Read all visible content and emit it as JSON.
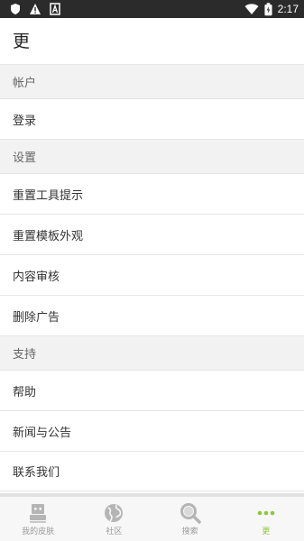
{
  "status_bar": {
    "time": "2:17",
    "icons": [
      "shield-icon",
      "warning-icon",
      "a-icon",
      "wifi-icon",
      "battery-icon"
    ]
  },
  "header": {
    "title": "更"
  },
  "sections": {
    "account": {
      "title": "帐户",
      "items": [
        "登录"
      ]
    },
    "settings": {
      "title": "设置",
      "items": [
        "重置工具提示",
        "重置模板外观",
        "内容审核",
        "删除广告"
      ]
    },
    "support": {
      "title": "支持",
      "items": [
        "帮助",
        "新闻与公告",
        "联系我们"
      ]
    }
  },
  "bottom_nav": {
    "items": [
      {
        "label": "我的皮肤",
        "icon": "skin-icon"
      },
      {
        "label": "社区",
        "icon": "globe-icon"
      },
      {
        "label": "搜索",
        "icon": "search-icon"
      },
      {
        "label": "更",
        "icon": "more-icon"
      }
    ],
    "active_index": 3
  },
  "colors": {
    "accent": "#8dc63f",
    "status_bar_bg": "#2b2b2b",
    "section_bg": "#f2f2f2"
  }
}
